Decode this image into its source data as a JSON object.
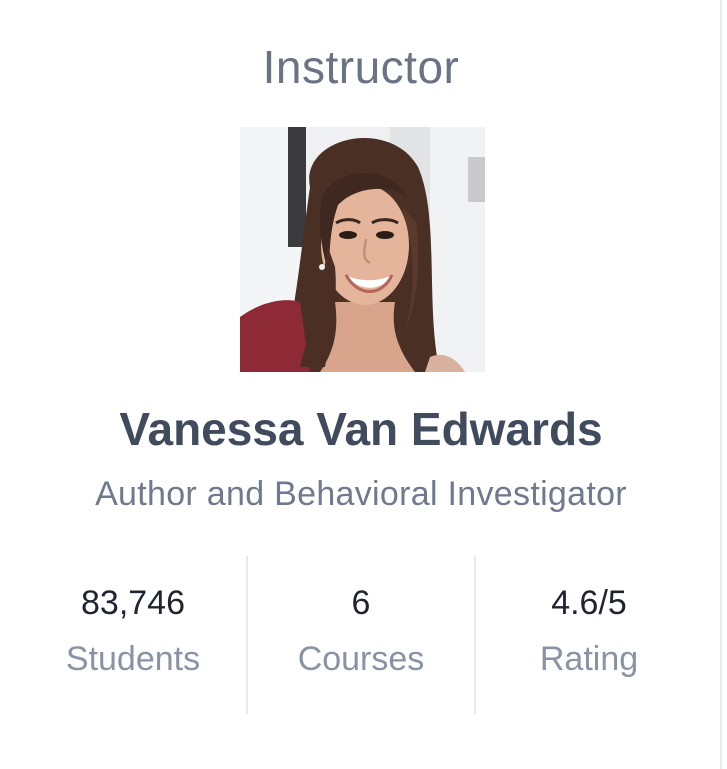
{
  "instructor_card": {
    "section_title": "Instructor",
    "name": "Vanessa Van Edwards",
    "headline": "Author and Behavioral Investigator",
    "photo_icon": "instructor-portrait",
    "stats": [
      {
        "value": "83,746",
        "label": "Students"
      },
      {
        "value": "6",
        "label": "Courses"
      },
      {
        "value": "4.6/5",
        "label": "Rating"
      }
    ]
  },
  "colors": {
    "title": "#6a7385",
    "name": "#414b5e",
    "headline": "#6f7a8e",
    "stat_value": "#1f2430",
    "stat_label": "#8a93a4",
    "divider": "#e6e8ec"
  }
}
